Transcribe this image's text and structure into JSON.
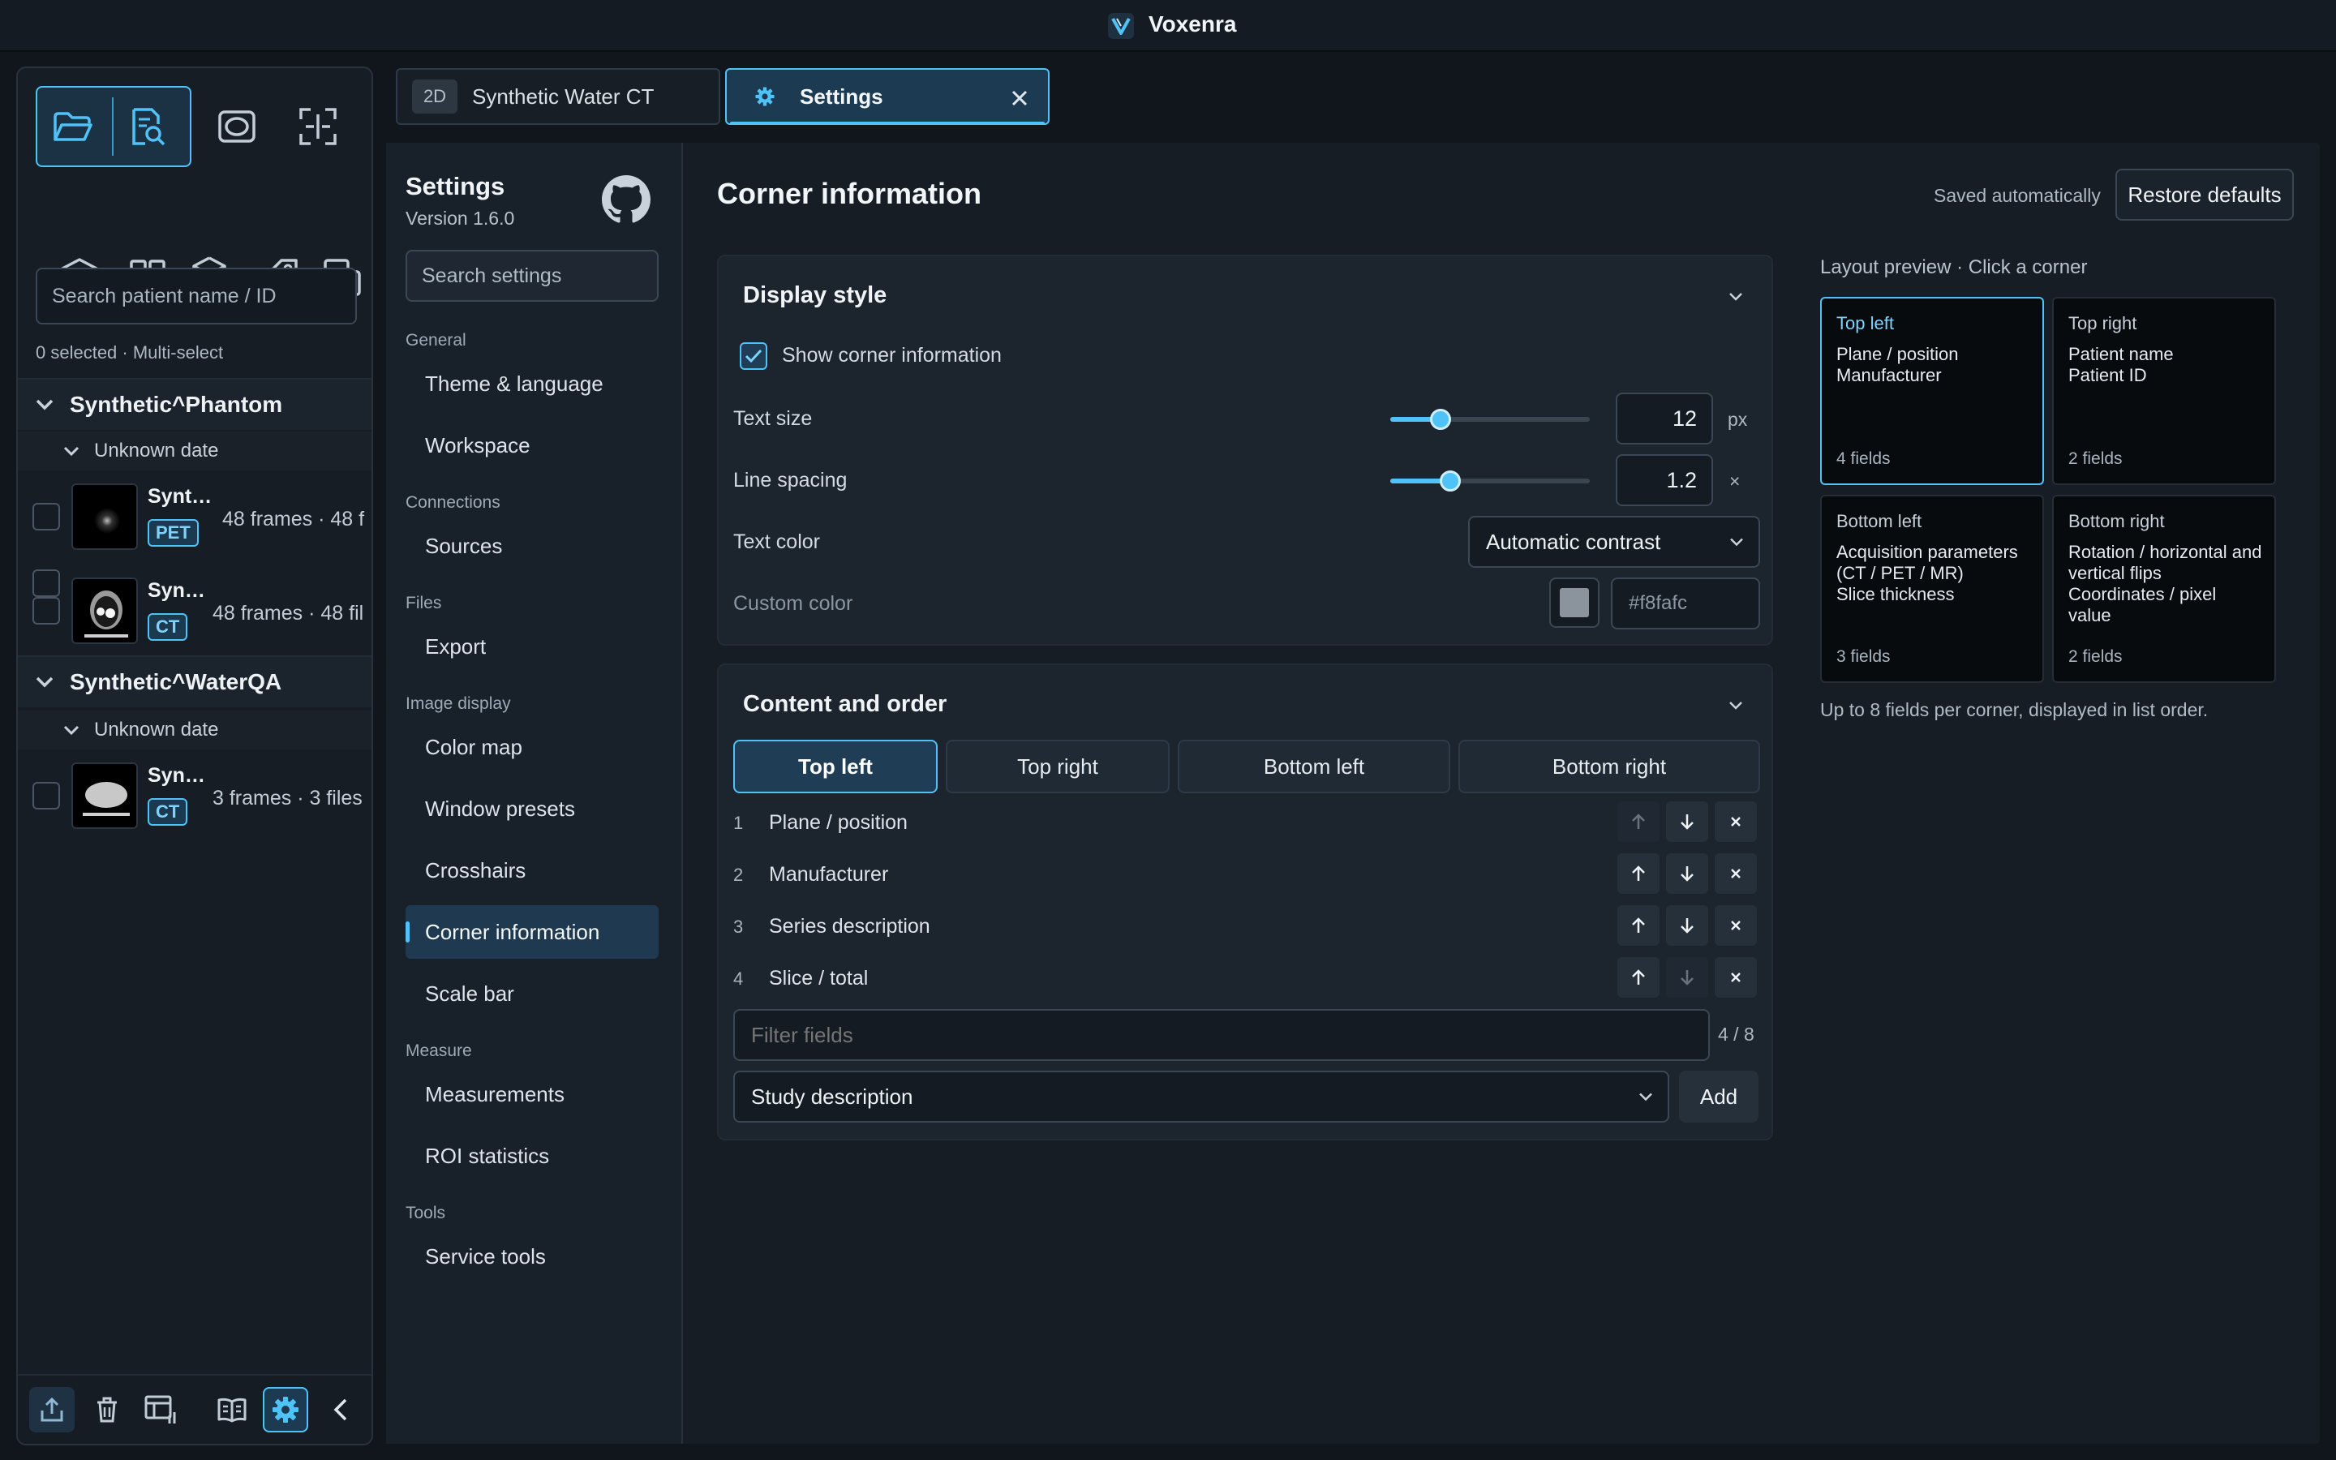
{
  "app": {
    "title": "Voxenra"
  },
  "sidebar": {
    "search_placeholder": "Search patient name / ID",
    "selection_info": "0 selected · Multi-select",
    "patients": [
      {
        "name": "Synthetic^Phantom",
        "date": "Unknown date",
        "series": [
          {
            "name": "Synt…",
            "modality": "PET",
            "meta": "48 frames · 48 f"
          },
          {
            "name": "Syn…",
            "modality": "CT",
            "meta": "48 frames · 48 fil"
          }
        ]
      },
      {
        "name": "Synthetic^WaterQA",
        "date": "Unknown date",
        "series": [
          {
            "name": "Syn…",
            "modality": "CT",
            "meta": "3 frames · 3 files"
          }
        ]
      }
    ]
  },
  "tabs": [
    {
      "tag": "2D",
      "label": "Synthetic Water CT"
    },
    {
      "label": "Settings"
    }
  ],
  "settings": {
    "title": "Settings",
    "version": "Version 1.6.0",
    "search_placeholder": "Search settings",
    "nav": [
      {
        "section": "General",
        "items": [
          "Theme & language",
          "Workspace"
        ]
      },
      {
        "section": "Connections",
        "items": [
          "Sources"
        ]
      },
      {
        "section": "Files",
        "items": [
          "Export"
        ]
      },
      {
        "section": "Image display",
        "items": [
          "Color map",
          "Window presets",
          "Crosshairs",
          "Corner information",
          "Scale bar"
        ]
      },
      {
        "section": "Measure",
        "items": [
          "Measurements",
          "ROI statistics"
        ]
      },
      {
        "section": "Tools",
        "items": [
          "Service tools"
        ]
      }
    ],
    "active_item": "Corner information"
  },
  "page": {
    "heading": "Corner information",
    "saved_text": "Saved automatically",
    "restore_label": "Restore defaults",
    "display_style": {
      "title": "Display style",
      "show_corner_label": "Show corner information",
      "show_corner_checked": true,
      "text_size_label": "Text size",
      "text_size_value": "12",
      "text_size_unit": "px",
      "text_size_fraction": 0.25,
      "line_spacing_label": "Line spacing",
      "line_spacing_value": "1.2",
      "line_spacing_unit": "×",
      "line_spacing_fraction": 0.3,
      "text_color_label": "Text color",
      "text_color_value": "Automatic contrast",
      "custom_color_label": "Custom color",
      "custom_color_value": "#f8fafc"
    },
    "content_order": {
      "title": "Content and order",
      "corners": [
        "Top left",
        "Top right",
        "Bottom left",
        "Bottom right"
      ],
      "active_corner": "Top left",
      "fields": [
        {
          "num": "1",
          "name": "Plane / position"
        },
        {
          "num": "2",
          "name": "Manufacturer"
        },
        {
          "num": "3",
          "name": "Series description"
        },
        {
          "num": "4",
          "name": "Slice / total"
        }
      ],
      "filter_placeholder": "Filter fields",
      "count": "4 / 8",
      "add_select_value": "Study description",
      "add_label": "Add"
    },
    "preview": {
      "label": "Layout preview · Click a corner",
      "corners": [
        {
          "title": "Top left",
          "fields": [
            "Plane / position",
            "Manufacturer"
          ],
          "count": "4 fields"
        },
        {
          "title": "Top right",
          "fields": [
            "Patient name",
            "Patient ID"
          ],
          "count": "2 fields"
        },
        {
          "title": "Bottom left",
          "fields": [
            "Acquisition parameters (CT / PET / MR)",
            "Slice thickness"
          ],
          "count": "3 fields"
        },
        {
          "title": "Bottom right",
          "fields": [
            "Rotation / horizontal and vertical flips",
            "Coordinates / pixel value"
          ],
          "count": "2 fields"
        }
      ],
      "note": "Up to 8 fields per corner, displayed in list order."
    }
  },
  "colors": {
    "accent": "#4fc3f7",
    "background": "#11161c",
    "panel": "#1c242d"
  }
}
